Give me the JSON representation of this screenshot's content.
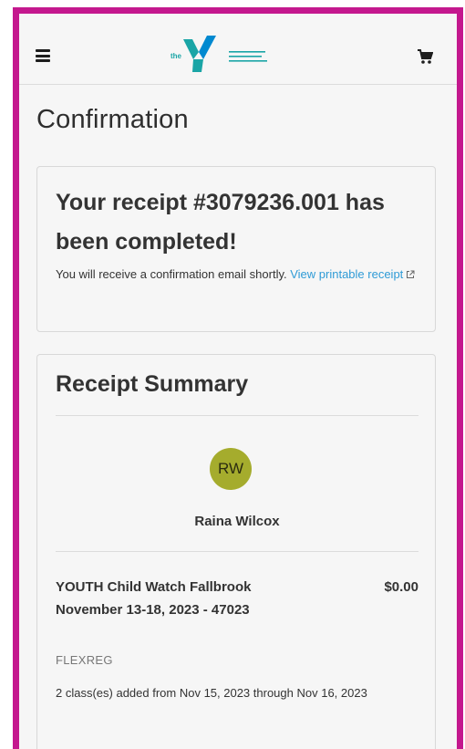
{
  "header": {
    "menu_icon": "hamburger-menu-icon",
    "logo_icon": "ymca-logo-icon",
    "logo_prefix": "the",
    "cart_icon": "shopping-cart-icon"
  },
  "page": {
    "title": "Confirmation"
  },
  "confirmation": {
    "heading": "Your receipt #3079236.001 has been completed!",
    "message": "You will receive a confirmation email shortly.",
    "link_text": "View printable receipt",
    "link_icon": "external-link-icon"
  },
  "summary": {
    "title": "Receipt Summary",
    "member": {
      "initials": "RW",
      "name": "Raina Wilcox"
    },
    "items": [
      {
        "name": "YOUTH Child Watch Fallbrook November 13-18, 2023 - 47023",
        "price": "$0.00",
        "type": "FLEXREG",
        "detail": "2 class(es) added from Nov 15, 2023 through Nov 16, 2023"
      }
    ]
  },
  "colors": {
    "frame": "#c4188e",
    "link": "#2f9bd6",
    "avatar": "#a5ac2d",
    "logo_teal": "#1aa5a6",
    "logo_blue": "#0089d0"
  }
}
